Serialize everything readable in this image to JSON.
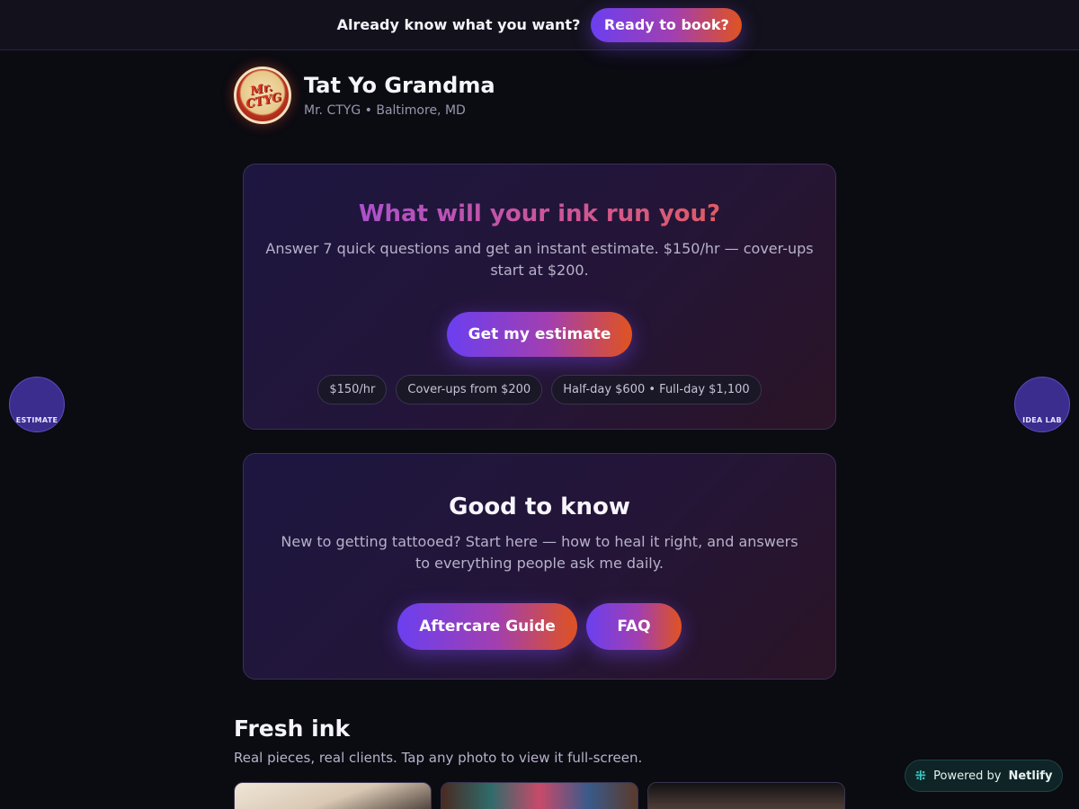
{
  "topbar": {
    "prompt": "Already know what you want?",
    "cta": "Ready to book?"
  },
  "brand": {
    "logo_text": "Mr. CTYG",
    "name": "Tat Yo Grandma",
    "subtitle": "Mr. CTYG • Baltimore, MD"
  },
  "estimate_card": {
    "title": "What will your ink run you?",
    "description": "Answer 7 quick questions and get an instant estimate. $150/hr — cover-ups start at $200.",
    "cta": "Get my estimate",
    "pills": [
      "$150/hr",
      "Cover-ups from $200",
      "Half-day $600 • Full-day $1,100"
    ]
  },
  "info_card": {
    "title": "Good to know",
    "description": "New to getting tattooed? Start here — how to heal it right, and answers to everything people ask me daily.",
    "buttons": [
      "Aftercare Guide",
      "FAQ"
    ]
  },
  "side_tabs": {
    "left": "ESTIMATE",
    "right": "IDEA LAB"
  },
  "gallery": {
    "title": "Fresh ink",
    "subtitle": "Real pieces, real clients. Tap any photo to view it full-screen."
  },
  "badge": {
    "prefix": "Powered by",
    "brand": "Netlify",
    "icon": "netlify-icon"
  },
  "colors": {
    "background": "#0b0b12",
    "gradient_start": "#6b3ff0",
    "gradient_end": "#e0531f",
    "bubble": "#3b2d8e"
  }
}
